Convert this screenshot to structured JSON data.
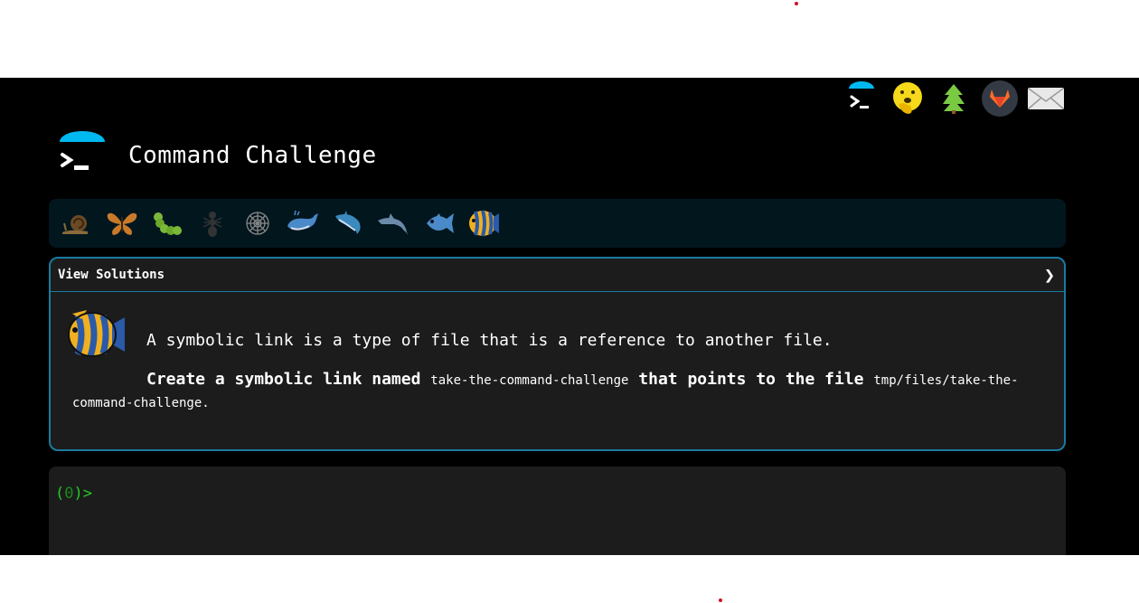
{
  "header": {
    "title": "Command Challenge"
  },
  "topnav": {
    "icons": [
      "terminal-logo-icon",
      "face-hand-over-mouth-icon",
      "evergreen-tree-icon",
      "gitlab-icon",
      "envelope-icon"
    ]
  },
  "levels": {
    "icons": [
      "snail-icon",
      "butterfly-icon",
      "caterpillar-icon",
      "ant-icon",
      "spider-web-icon",
      "whale-icon",
      "shark-icon",
      "dolphin-icon",
      "fish-icon",
      "tropical-fish-icon"
    ]
  },
  "panel": {
    "toggle_label": "View Solutions",
    "chevron": "❯",
    "intro": "A symbolic link is a type of file that is a reference to another file.",
    "task_prefix": "Create a symbolic link named ",
    "link_name": "take-the-command-challenge",
    "task_middle": " that points to the file ",
    "target_path": "tmp/files/take-the-command-challenge",
    "task_suffix": "."
  },
  "terminal": {
    "prompt_open": "(",
    "exit_code": "0",
    "prompt_close": ")>"
  },
  "colors": {
    "accent": "#1a7aa0",
    "logo_cap": "#00b8f0",
    "prompt": "#22cc22",
    "level_bar": "#02161e",
    "panel_bg": "#1c1c1c"
  }
}
